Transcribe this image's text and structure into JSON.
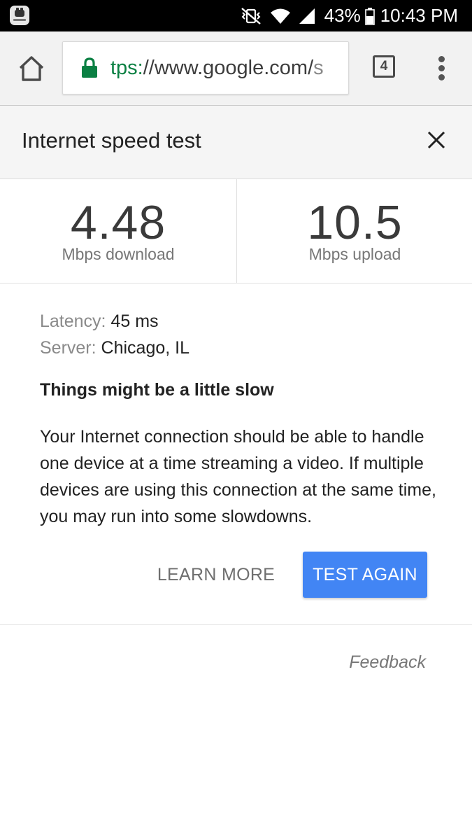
{
  "status_bar": {
    "app_badge_icon": "galaxy-app-icon",
    "icons": [
      "vibrate-mute-icon",
      "wifi-icon",
      "cell-signal-icon"
    ],
    "battery_percent": "43%",
    "battery_icon": "battery-icon",
    "time": "10:43 PM"
  },
  "browser": {
    "home_icon": "home-icon",
    "lock_icon": "lock-icon",
    "url_scheme": "tps:",
    "url_host": "//www.google.com/",
    "url_path": "s",
    "tab_count": "4",
    "menu_icon": "more-vert-icon"
  },
  "card": {
    "title": "Internet speed test",
    "close_icon": "close-icon"
  },
  "results": {
    "download_value": "4.48",
    "download_label": "Mbps download",
    "upload_value": "10.5",
    "upload_label": "Mbps upload"
  },
  "details": {
    "latency_label": "Latency:",
    "latency_value": "45 ms",
    "server_label": "Server:",
    "server_value": "Chicago, IL",
    "verdict": "Things might be a little slow",
    "explanation": "Your Internet connection should be able to handle one device at a time streaming a video. If multiple devices are using this connection at the same time, you may run into some slowdowns."
  },
  "actions": {
    "learn_more": "LEARN MORE",
    "test_again": "TEST AGAIN"
  },
  "footer": {
    "feedback": "Feedback"
  },
  "colors": {
    "accent_blue": "#4285f4",
    "secure_green": "#0b8043",
    "status_bar_bg": "#000000"
  }
}
